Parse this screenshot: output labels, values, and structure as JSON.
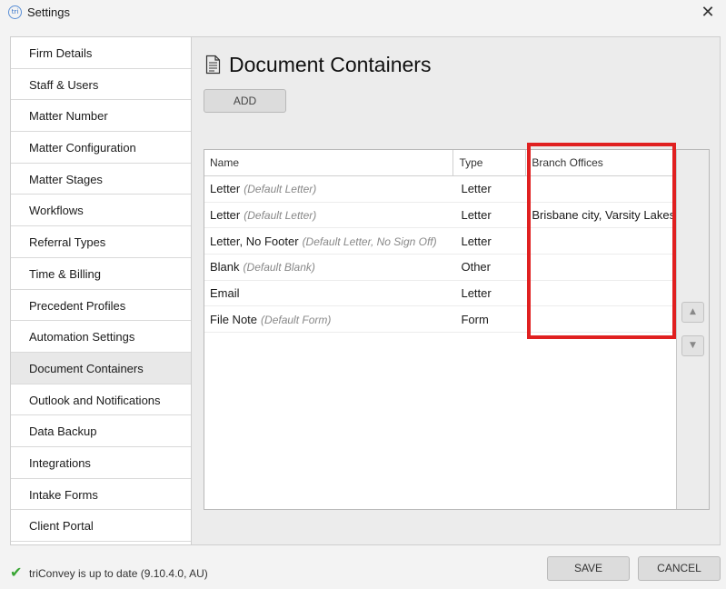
{
  "window": {
    "title": "Settings",
    "app_icon_text": "tri",
    "close_glyph": "✕"
  },
  "sidebar": {
    "items": [
      {
        "label": "Firm Details"
      },
      {
        "label": "Staff & Users"
      },
      {
        "label": "Matter Number"
      },
      {
        "label": "Matter Configuration"
      },
      {
        "label": "Matter Stages"
      },
      {
        "label": "Workflows"
      },
      {
        "label": "Referral Types"
      },
      {
        "label": "Time & Billing"
      },
      {
        "label": "Precedent Profiles"
      },
      {
        "label": "Automation Settings"
      },
      {
        "label": "Document Containers",
        "active": true
      },
      {
        "label": "Outlook and Notifications"
      },
      {
        "label": "Data Backup"
      },
      {
        "label": "Integrations"
      },
      {
        "label": "Intake Forms"
      },
      {
        "label": "Client Portal"
      }
    ]
  },
  "main": {
    "title": "Document Containers",
    "title_icon": "document-icon",
    "add_label": "ADD",
    "table": {
      "columns": [
        "Name",
        "Type",
        "Branch Offices"
      ],
      "rows": [
        {
          "name": "Letter",
          "default": "(Default Letter)",
          "type": "Letter",
          "branch": ""
        },
        {
          "name": "Letter",
          "default": "(Default Letter)",
          "type": "Letter",
          "branch": "Brisbane city, Varsity Lakes"
        },
        {
          "name": "Letter, No Footer",
          "default": "(Default Letter, No Sign Off)",
          "type": "Letter",
          "branch": ""
        },
        {
          "name": "Blank",
          "default": "(Default Blank)",
          "type": "Other",
          "branch": ""
        },
        {
          "name": "Email",
          "default": "",
          "type": "Letter",
          "branch": ""
        },
        {
          "name": "File Note",
          "default": "(Default Form)",
          "type": "Form",
          "branch": ""
        }
      ]
    },
    "move_up_glyph": "▲",
    "move_down_glyph": "▼"
  },
  "footer": {
    "status_icon": "check-icon",
    "status_glyph": "✔",
    "status_text": "triConvey is up to date (9.10.4.0, AU)",
    "save_label": "SAVE",
    "cancel_label": "CANCEL"
  },
  "colors": {
    "highlight_border": "#e02020",
    "status_check": "#3aa635"
  }
}
